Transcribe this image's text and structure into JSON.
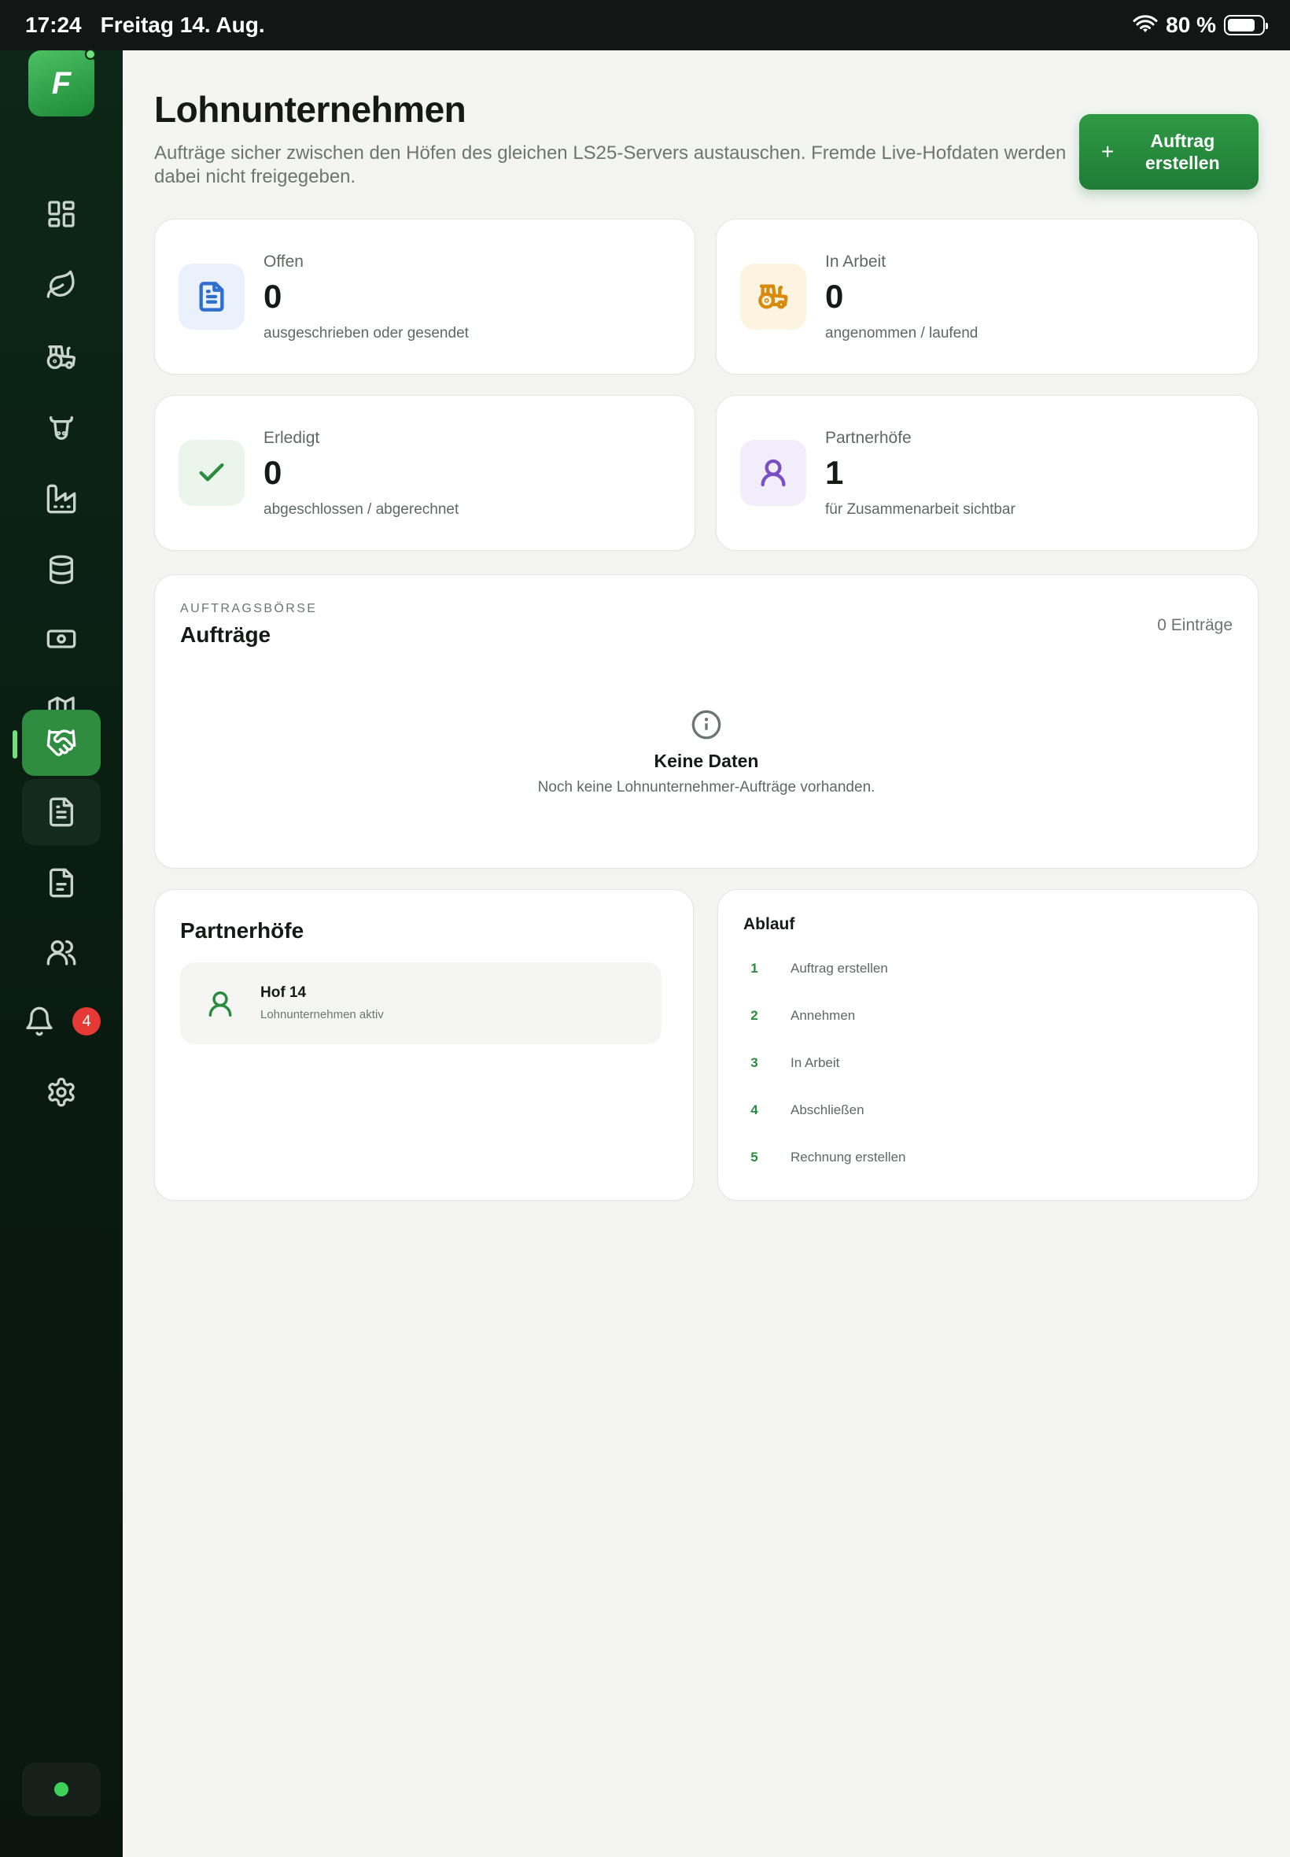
{
  "statusbar": {
    "time": "17:24",
    "date": "Freitag 14. Aug.",
    "battery": "80 %",
    "battery_level": 0.8
  },
  "sidebar": {
    "logo": "F",
    "notifications_badge": "4",
    "items": [
      {
        "icon": "dashboard-icon"
      },
      {
        "icon": "leaf-icon"
      },
      {
        "icon": "tractor-icon"
      },
      {
        "icon": "cow-icon"
      },
      {
        "icon": "factory-icon"
      },
      {
        "icon": "database-icon"
      },
      {
        "icon": "money-icon"
      },
      {
        "icon": "map-icon"
      },
      {
        "icon": "handshake-icon",
        "active": true
      },
      {
        "icon": "document-icon"
      },
      {
        "icon": "invoice-icon"
      },
      {
        "icon": "users-icon"
      },
      {
        "icon": "bell-icon"
      },
      {
        "icon": "gear-icon"
      }
    ]
  },
  "header": {
    "title": "Lohnunternehmen",
    "subtitle": "Aufträge sicher zwischen den Höfen des gleichen LS25-Servers austauschen. Fremde Live-Hofdaten werden dabei nicht freigegeben.",
    "create_button": "Auftrag erstellen"
  },
  "stats": [
    {
      "label": "Offen",
      "value": "0",
      "sub": "ausgeschrieben oder gesendet",
      "icon": "document-icon",
      "color": "#2f6fd0",
      "bg": "#eaf1fd"
    },
    {
      "label": "In Arbeit",
      "value": "0",
      "sub": "angenommen / laufend",
      "icon": "tractor-icon",
      "color": "#d98a0b",
      "bg": "#fdf3e1"
    },
    {
      "label": "Erledigt",
      "value": "0",
      "sub": "abgeschlossen / abgerechnet",
      "icon": "check-icon",
      "color": "#2a8b3f",
      "bg": "#eaf5ec"
    },
    {
      "label": "Partnerhöfe",
      "value": "1",
      "sub": "für Zusammenarbeit sichtbar",
      "icon": "user-icon",
      "color": "#7b4fc4",
      "bg": "#f2edfb"
    }
  ],
  "orders": {
    "kicker": "AUFTRAGSBÖRSE",
    "title": "Aufträge",
    "entries": "0 Einträge",
    "empty_title": "Keine Daten",
    "empty_text": "Noch keine Lohnunternehmer-Aufträge vorhanden."
  },
  "partners": {
    "title": "Partnerhöfe",
    "items": [
      {
        "name": "Hof 14",
        "status": "Lohnunternehmen aktiv"
      }
    ]
  },
  "flow": {
    "title": "Ablauf",
    "steps": [
      {
        "num": "1",
        "label": "Auftrag erstellen"
      },
      {
        "num": "2",
        "label": "Annehmen"
      },
      {
        "num": "3",
        "label": "In Arbeit"
      },
      {
        "num": "4",
        "label": "Abschließen"
      },
      {
        "num": "5",
        "label": "Rechnung erstellen"
      }
    ]
  }
}
